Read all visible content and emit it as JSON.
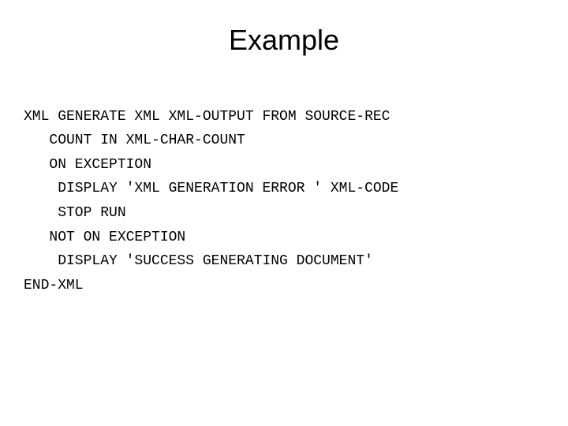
{
  "title": "Example",
  "code_lines": {
    "l0": "XML GENERATE XML XML-OUTPUT FROM SOURCE-REC",
    "l1": "   COUNT IN XML-CHAR-COUNT",
    "l2": "   ON EXCEPTION",
    "l3": "    DISPLAY 'XML GENERATION ERROR ' XML-CODE",
    "l4": "    STOP RUN",
    "l5": "   NOT ON EXCEPTION",
    "l6": "    DISPLAY 'SUCCESS GENERATING DOCUMENT'",
    "l7": "END-XML"
  }
}
